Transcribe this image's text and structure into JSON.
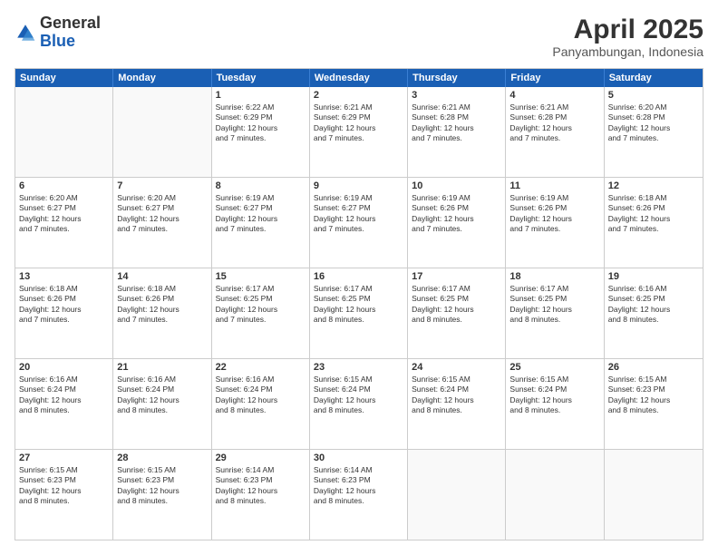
{
  "logo": {
    "line1": "General",
    "line2": "Blue"
  },
  "header": {
    "title": "April 2025",
    "subtitle": "Panyambungan, Indonesia"
  },
  "days": [
    "Sunday",
    "Monday",
    "Tuesday",
    "Wednesday",
    "Thursday",
    "Friday",
    "Saturday"
  ],
  "weeks": [
    [
      {
        "day": "",
        "content": ""
      },
      {
        "day": "",
        "content": ""
      },
      {
        "day": "1",
        "content": "Sunrise: 6:22 AM\nSunset: 6:29 PM\nDaylight: 12 hours\nand 7 minutes."
      },
      {
        "day": "2",
        "content": "Sunrise: 6:21 AM\nSunset: 6:29 PM\nDaylight: 12 hours\nand 7 minutes."
      },
      {
        "day": "3",
        "content": "Sunrise: 6:21 AM\nSunset: 6:28 PM\nDaylight: 12 hours\nand 7 minutes."
      },
      {
        "day": "4",
        "content": "Sunrise: 6:21 AM\nSunset: 6:28 PM\nDaylight: 12 hours\nand 7 minutes."
      },
      {
        "day": "5",
        "content": "Sunrise: 6:20 AM\nSunset: 6:28 PM\nDaylight: 12 hours\nand 7 minutes."
      }
    ],
    [
      {
        "day": "6",
        "content": "Sunrise: 6:20 AM\nSunset: 6:27 PM\nDaylight: 12 hours\nand 7 minutes."
      },
      {
        "day": "7",
        "content": "Sunrise: 6:20 AM\nSunset: 6:27 PM\nDaylight: 12 hours\nand 7 minutes."
      },
      {
        "day": "8",
        "content": "Sunrise: 6:19 AM\nSunset: 6:27 PM\nDaylight: 12 hours\nand 7 minutes."
      },
      {
        "day": "9",
        "content": "Sunrise: 6:19 AM\nSunset: 6:27 PM\nDaylight: 12 hours\nand 7 minutes."
      },
      {
        "day": "10",
        "content": "Sunrise: 6:19 AM\nSunset: 6:26 PM\nDaylight: 12 hours\nand 7 minutes."
      },
      {
        "day": "11",
        "content": "Sunrise: 6:19 AM\nSunset: 6:26 PM\nDaylight: 12 hours\nand 7 minutes."
      },
      {
        "day": "12",
        "content": "Sunrise: 6:18 AM\nSunset: 6:26 PM\nDaylight: 12 hours\nand 7 minutes."
      }
    ],
    [
      {
        "day": "13",
        "content": "Sunrise: 6:18 AM\nSunset: 6:26 PM\nDaylight: 12 hours\nand 7 minutes."
      },
      {
        "day": "14",
        "content": "Sunrise: 6:18 AM\nSunset: 6:26 PM\nDaylight: 12 hours\nand 7 minutes."
      },
      {
        "day": "15",
        "content": "Sunrise: 6:17 AM\nSunset: 6:25 PM\nDaylight: 12 hours\nand 7 minutes."
      },
      {
        "day": "16",
        "content": "Sunrise: 6:17 AM\nSunset: 6:25 PM\nDaylight: 12 hours\nand 8 minutes."
      },
      {
        "day": "17",
        "content": "Sunrise: 6:17 AM\nSunset: 6:25 PM\nDaylight: 12 hours\nand 8 minutes."
      },
      {
        "day": "18",
        "content": "Sunrise: 6:17 AM\nSunset: 6:25 PM\nDaylight: 12 hours\nand 8 minutes."
      },
      {
        "day": "19",
        "content": "Sunrise: 6:16 AM\nSunset: 6:25 PM\nDaylight: 12 hours\nand 8 minutes."
      }
    ],
    [
      {
        "day": "20",
        "content": "Sunrise: 6:16 AM\nSunset: 6:24 PM\nDaylight: 12 hours\nand 8 minutes."
      },
      {
        "day": "21",
        "content": "Sunrise: 6:16 AM\nSunset: 6:24 PM\nDaylight: 12 hours\nand 8 minutes."
      },
      {
        "day": "22",
        "content": "Sunrise: 6:16 AM\nSunset: 6:24 PM\nDaylight: 12 hours\nand 8 minutes."
      },
      {
        "day": "23",
        "content": "Sunrise: 6:15 AM\nSunset: 6:24 PM\nDaylight: 12 hours\nand 8 minutes."
      },
      {
        "day": "24",
        "content": "Sunrise: 6:15 AM\nSunset: 6:24 PM\nDaylight: 12 hours\nand 8 minutes."
      },
      {
        "day": "25",
        "content": "Sunrise: 6:15 AM\nSunset: 6:24 PM\nDaylight: 12 hours\nand 8 minutes."
      },
      {
        "day": "26",
        "content": "Sunrise: 6:15 AM\nSunset: 6:23 PM\nDaylight: 12 hours\nand 8 minutes."
      }
    ],
    [
      {
        "day": "27",
        "content": "Sunrise: 6:15 AM\nSunset: 6:23 PM\nDaylight: 12 hours\nand 8 minutes."
      },
      {
        "day": "28",
        "content": "Sunrise: 6:15 AM\nSunset: 6:23 PM\nDaylight: 12 hours\nand 8 minutes."
      },
      {
        "day": "29",
        "content": "Sunrise: 6:14 AM\nSunset: 6:23 PM\nDaylight: 12 hours\nand 8 minutes."
      },
      {
        "day": "30",
        "content": "Sunrise: 6:14 AM\nSunset: 6:23 PM\nDaylight: 12 hours\nand 8 minutes."
      },
      {
        "day": "",
        "content": ""
      },
      {
        "day": "",
        "content": ""
      },
      {
        "day": "",
        "content": ""
      }
    ]
  ]
}
